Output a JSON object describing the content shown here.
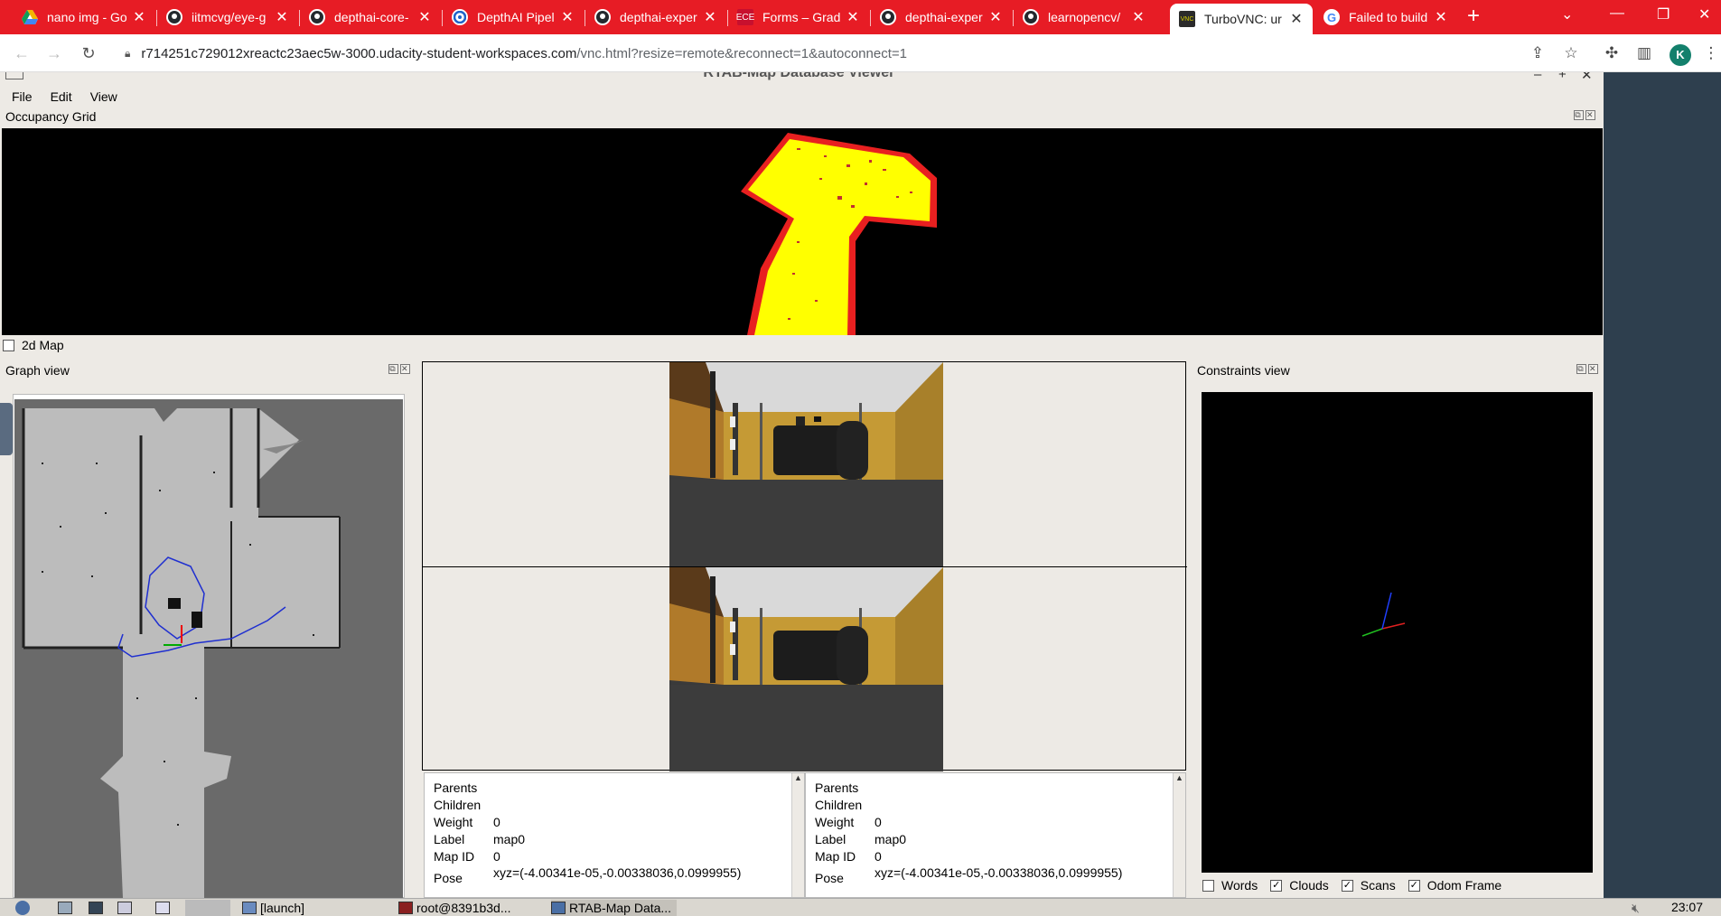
{
  "browser": {
    "tabs": [
      {
        "label": "nano img - Go",
        "icon": "google-drive-icon",
        "color": "#f4b400"
      },
      {
        "label": "iitmcvg/eye-g",
        "icon": "github-icon",
        "color": "#24292e"
      },
      {
        "label": "depthai-core-",
        "icon": "github-icon",
        "color": "#24292e"
      },
      {
        "label": "DepthAI Pipeli",
        "icon": "depthai-icon",
        "color": "#1e63c9"
      },
      {
        "label": "depthai-exper",
        "icon": "github-icon",
        "color": "#24292e"
      },
      {
        "label": "Forms – Gradu",
        "icon": "forms-icon",
        "color": "#c8102e"
      },
      {
        "label": "depthai-exper",
        "icon": "github-icon",
        "color": "#24292e"
      },
      {
        "label": "learnopencv/",
        "icon": "github-icon",
        "color": "#24292e"
      },
      {
        "label": "TurboVNC: ur",
        "icon": "vnc-icon",
        "color": "#2a2a2a"
      },
      {
        "label": "Failed to build",
        "icon": "google-icon",
        "color": "#4285f4"
      }
    ],
    "active_tab": 8,
    "url_host": "r714251c729012xreactc23aec5w-3000.udacity-student-workspaces.com",
    "url_path": "/vnc.html?resize=remote&reconnect=1&autoconnect=1",
    "profile_initial": "K",
    "profile_color": "#13806c",
    "tabbar_color": "#e71c25"
  },
  "app": {
    "title": "RTAB-Map Database Viewer*",
    "menus": [
      "File",
      "Edit",
      "View"
    ],
    "occupancy_title": "Occupancy Grid",
    "map2d_label": "2d Map",
    "graph_title": "Graph view",
    "constraints_title": "Constraints view",
    "info_left": {
      "rows": [
        {
          "k": "Parents",
          "v": ""
        },
        {
          "k": "Children",
          "v": ""
        },
        {
          "k": "Weight",
          "v": "0"
        },
        {
          "k": "Label",
          "v": "map0"
        },
        {
          "k": "Map ID",
          "v": "0"
        },
        {
          "k": "Pose",
          "v": "xyz=(-4.00341e-05,-0.00338036,0.0999955)"
        }
      ]
    },
    "info_right": {
      "rows": [
        {
          "k": "Parents",
          "v": ""
        },
        {
          "k": "Children",
          "v": ""
        },
        {
          "k": "Weight",
          "v": "0"
        },
        {
          "k": "Label",
          "v": "map0"
        },
        {
          "k": "Map ID",
          "v": "0"
        },
        {
          "k": "Pose",
          "v": "xyz=(-4.00341e-05,-0.00338036,0.0999955)"
        }
      ]
    },
    "constraint_checks": [
      {
        "label": "Words",
        "checked": false
      },
      {
        "label": "Clouds",
        "checked": true
      },
      {
        "label": "Scans",
        "checked": true
      },
      {
        "label": "Odom Frame",
        "checked": true
      }
    ]
  },
  "taskbar": {
    "items": [
      "[launch]",
      "root@8391b3d...",
      "RTAB-Map Data..."
    ],
    "clock": "23:07"
  }
}
